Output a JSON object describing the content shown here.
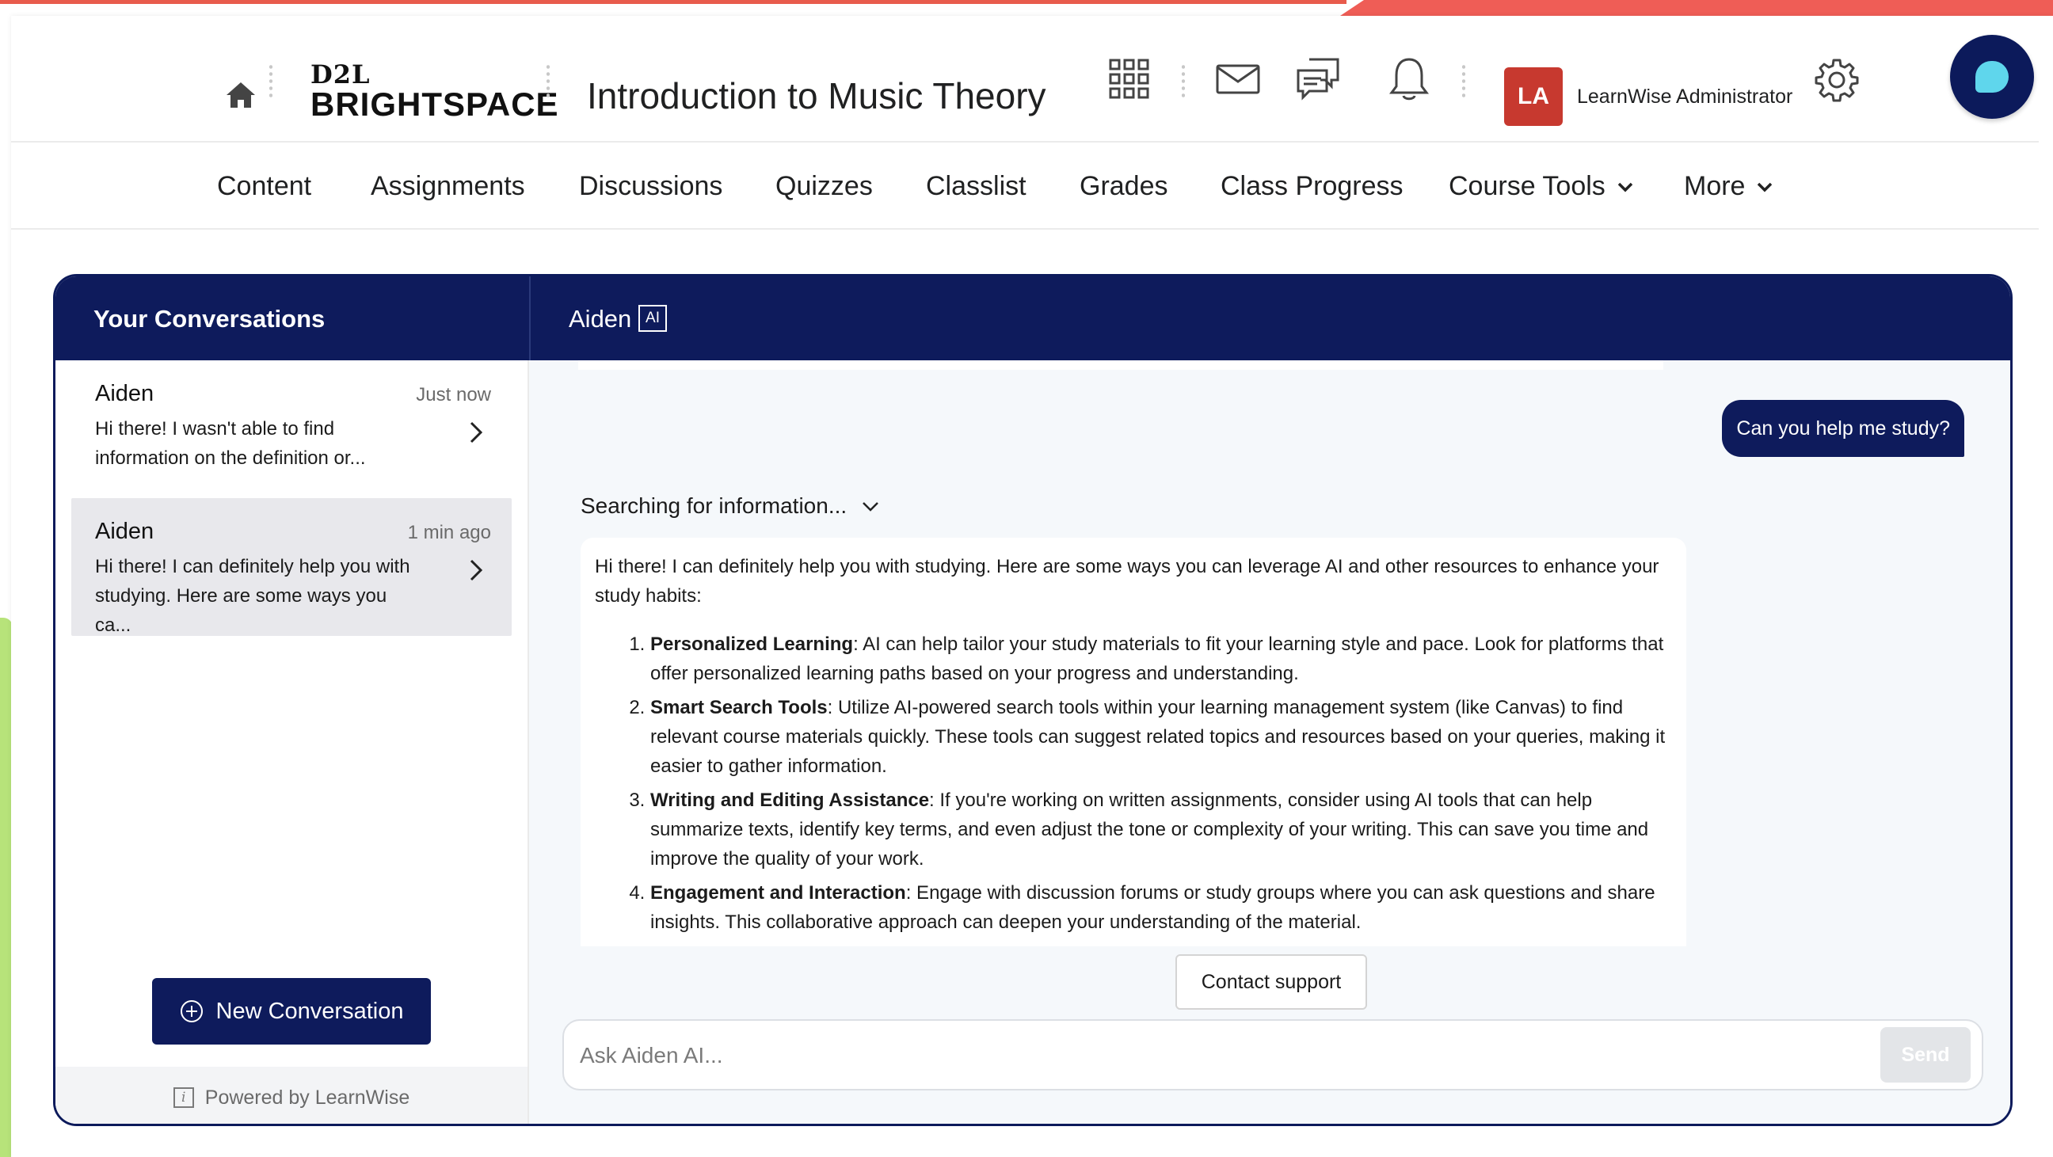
{
  "header": {
    "logo_top": "D2L",
    "logo_bottom": "BRIGHTSPACE",
    "course_title": "Introduction to Music Theory",
    "avatar_initials": "LA",
    "user_name": "LearnWise Administrator",
    "accent_color": "#0e1b5c",
    "avatar_color": "#c7392f"
  },
  "nav": {
    "items": [
      {
        "label": "Content"
      },
      {
        "label": "Assignments"
      },
      {
        "label": "Discussions"
      },
      {
        "label": "Quizzes"
      },
      {
        "label": "Classlist"
      },
      {
        "label": "Grades"
      },
      {
        "label": "Class Progress"
      },
      {
        "label": "Course Tools"
      },
      {
        "label": "More"
      }
    ]
  },
  "conversations": {
    "title": "Your Conversations",
    "items": [
      {
        "name": "Aiden",
        "time": "Just now",
        "preview": "Hi there! I wasn't able to find information on the definition or..."
      },
      {
        "name": "Aiden",
        "time": "1 min ago",
        "preview": "Hi there! I can definitely help you with studying. Here are some ways you ca..."
      }
    ],
    "new_button": "New Conversation",
    "powered_by": "Powered by LearnWise"
  },
  "chat": {
    "agent_name": "Aiden",
    "ai_badge": "AI",
    "user_message": "Can you help me study?",
    "searching_label": "Searching for information...",
    "answer_intro": "Hi there! I can definitely help you with studying. Here are some ways you can leverage AI and other resources to enhance your study habits:",
    "answer_items": [
      {
        "title": "Personalized Learning",
        "text": ": AI can help tailor your study materials to fit your learning style and pace. Look for platforms that offer personalized learning paths based on your progress and understanding."
      },
      {
        "title": "Smart Search Tools",
        "text": ": Utilize AI-powered search tools within your learning management system (like Canvas) to find relevant course materials quickly. These tools can suggest related topics and resources based on your queries, making it easier to gather information."
      },
      {
        "title": "Writing and Editing Assistance",
        "text": ": If you're working on written assignments, consider using AI tools that can help summarize texts, identify key terms, and even adjust the tone or complexity of your writing. This can save you time and improve the quality of your work."
      },
      {
        "title": "Engagement and Interaction",
        "text": ": Engage with discussion forums or study groups where you can ask questions and share insights. This collaborative approach can deepen your understanding of the material."
      }
    ],
    "contact_support": "Contact support",
    "input_placeholder": "Ask Aiden AI...",
    "send_label": "Send"
  }
}
